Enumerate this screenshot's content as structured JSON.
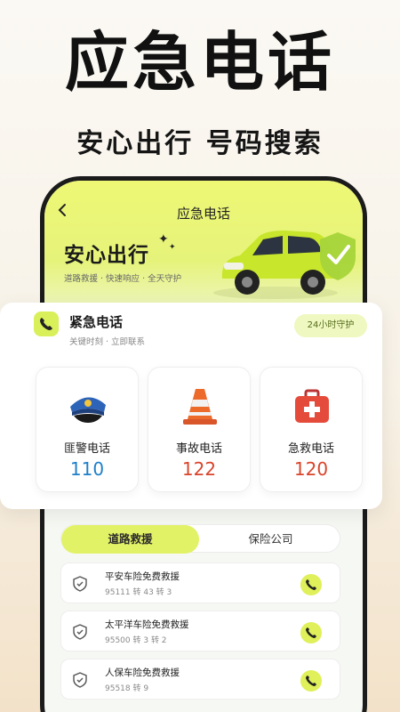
{
  "hero": {
    "title": "应急电话",
    "subtitle": "安心出行 号码搜索"
  },
  "nav": {
    "back_icon": "chevron-left-icon",
    "title": "应急电话"
  },
  "banner": {
    "title": "安心出行",
    "subtitle": "道路救援 · 快速响应 · 全天守护"
  },
  "emergency": {
    "title": "紧急电话",
    "subtitle": "关键时刻 · 立即联系",
    "badge": "24小时守护",
    "cards": [
      {
        "label": "匪警电话",
        "number": "110",
        "icon": "police-cap-icon",
        "color": "#1e7fc9"
      },
      {
        "label": "事故电话",
        "number": "122",
        "icon": "traffic-cone-icon",
        "color": "#d9442b"
      },
      {
        "label": "急救电话",
        "number": "120",
        "icon": "first-aid-kit-icon",
        "color": "#d9442b"
      }
    ]
  },
  "tabs": {
    "active": "道路救援",
    "inactive": "保险公司"
  },
  "rescue_list": [
    {
      "name": "平安车险免费救援",
      "phone": "95111 转 43 转 3"
    },
    {
      "name": "太平洋车险免费救援",
      "phone": "95500 转 3 转 2"
    },
    {
      "name": "人保车险免费救援",
      "phone": "95518 转 9"
    }
  ],
  "colors": {
    "accent": "#e2f266",
    "blue_number": "#1e7fc9",
    "red_number": "#d9442b"
  }
}
